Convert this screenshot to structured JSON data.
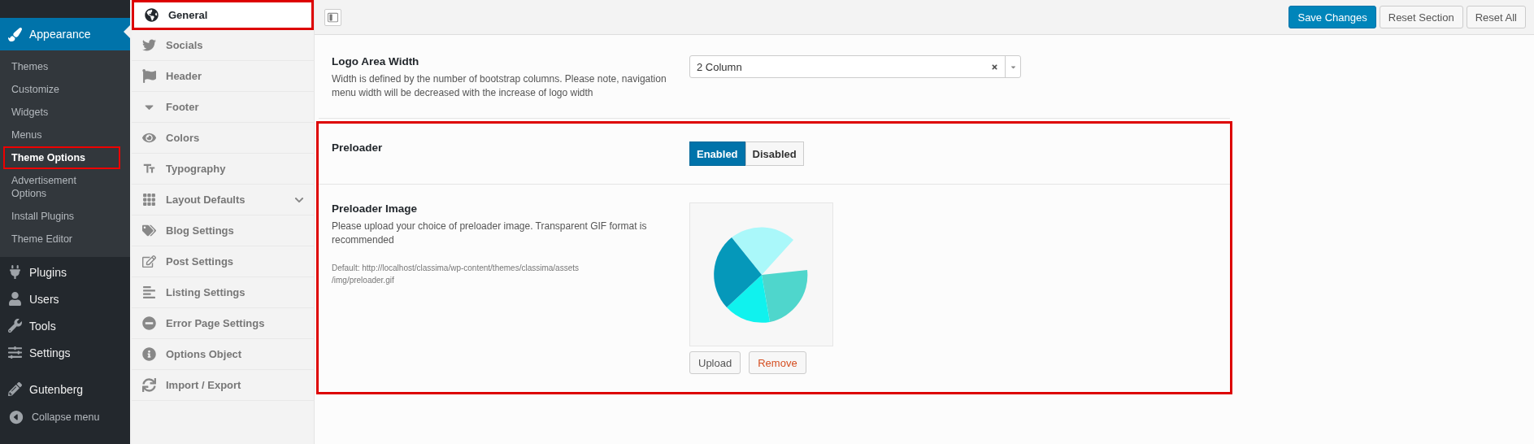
{
  "admin_menu": {
    "current": {
      "label": "Appearance",
      "selected": true,
      "submenu": [
        {
          "label": "Themes",
          "selected": false
        },
        {
          "label": "Customize",
          "selected": false
        },
        {
          "label": "Widgets",
          "selected": false
        },
        {
          "label": "Menus",
          "selected": false
        },
        {
          "label": "Theme Options",
          "selected": true,
          "highlighted": true
        },
        {
          "label": "Advertisement Options",
          "selected": false
        },
        {
          "label": "Install Plugins",
          "selected": false
        },
        {
          "label": "Theme Editor",
          "selected": false
        }
      ]
    },
    "items": [
      {
        "label": "Plugins",
        "selected": false
      },
      {
        "label": "Users",
        "selected": false
      },
      {
        "label": "Tools",
        "selected": false
      },
      {
        "label": "Settings",
        "selected": false
      },
      {
        "label": "Gutenberg",
        "selected": false
      },
      {
        "label": "Collapse menu",
        "kind": "collapse",
        "selected": false
      }
    ]
  },
  "options_menu": [
    {
      "label": "General",
      "selected": true,
      "highlighted": true
    },
    {
      "label": "Socials",
      "selected": false
    },
    {
      "label": "Header",
      "selected": false
    },
    {
      "label": "Footer",
      "selected": false
    },
    {
      "label": "Colors",
      "selected": false
    },
    {
      "label": "Typography",
      "selected": false
    },
    {
      "label": "Layout Defaults",
      "selected": false,
      "expandable": true
    },
    {
      "label": "Blog Settings",
      "selected": false
    },
    {
      "label": "Post Settings",
      "selected": false
    },
    {
      "label": "Listing Settings",
      "selected": false
    },
    {
      "label": "Error Page Settings",
      "selected": false
    },
    {
      "label": "Options Object",
      "selected": false
    },
    {
      "label": "Import / Export",
      "selected": false
    }
  ],
  "toolbar": {
    "buttons": [
      {
        "label": "Save Changes",
        "kind": "primary"
      },
      {
        "label": "Reset Section",
        "kind": "default"
      },
      {
        "label": "Reset All",
        "kind": "default"
      }
    ]
  },
  "settings": [
    {
      "kind": "select",
      "title": "Logo Area Width",
      "description": "Width is defined by the number of bootstrap columns. Please note, navigation menu width will be decreased with the increase of logo width",
      "value": "2 Column",
      "highlighted": false
    },
    {
      "kind": "toggle",
      "title": "Preloader",
      "options": [
        {
          "label": "Enabled",
          "selected": true
        },
        {
          "label": "Disabled",
          "selected": false
        }
      ],
      "highlighted": true
    },
    {
      "kind": "media",
      "title": "Preloader Image",
      "description": "Please upload your choice of preloader image. Transparent GIF format is recommended",
      "default": "Default: http://localhost/classima/wp-content/themes/classima/assets /img/preloader.gif",
      "buttons": [
        {
          "label": "Upload",
          "kind": "default"
        },
        {
          "label": "Remove",
          "kind": "danger"
        }
      ],
      "highlighted": true
    }
  ]
}
